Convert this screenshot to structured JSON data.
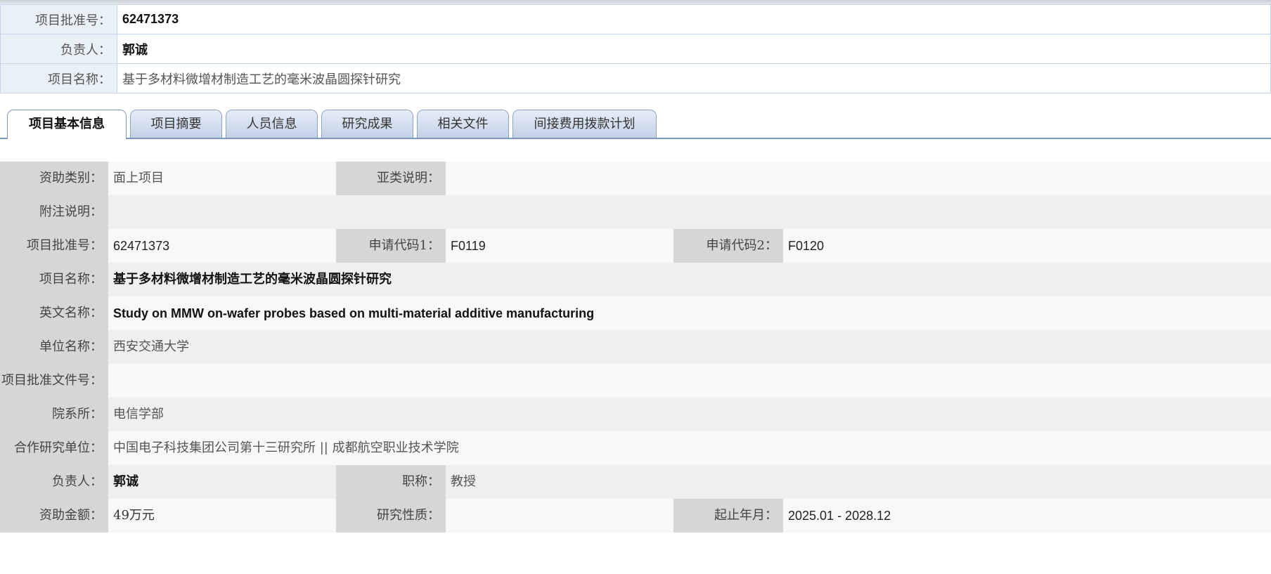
{
  "header": {
    "approval_no_label": "项目批准号：",
    "approval_no": "62471373",
    "leader_label": "负责人：",
    "leader": "郭诚",
    "project_name_label": "项目名称：",
    "project_name": "基于多材料微增材制造工艺的毫米波晶圆探针研究"
  },
  "tabs": [
    {
      "label": "项目基本信息",
      "active": true
    },
    {
      "label": "项目摘要"
    },
    {
      "label": "人员信息"
    },
    {
      "label": "研究成果"
    },
    {
      "label": "相关文件"
    },
    {
      "label": "间接费用拨款计划"
    }
  ],
  "details": {
    "funding_type_label": "资助类别：",
    "funding_type": "面上项目",
    "subtype_label": "亚类说明：",
    "subtype": "",
    "note_label": "附注说明：",
    "note": "",
    "approval_no_label": "项目批准号：",
    "approval_no": "62471373",
    "code1_label": "申请代码1：",
    "code1": "F0119",
    "code2_label": "申请代码2：",
    "code2": "F0120",
    "project_name_label": "项目名称：",
    "project_name": "基于多材料微增材制造工艺的毫米波晶圆探针研究",
    "english_name_label": "英文名称：",
    "english_name": "Study on MMW on-wafer probes based on multi-material additive manufacturing",
    "institution_label": "单位名称：",
    "institution": "西安交通大学",
    "approval_doc_label": "项目批准文件号：",
    "approval_doc": "",
    "department_label": "院系所：",
    "department": "电信学部",
    "partners_label": "合作研究单位：",
    "partners": "中国电子科技集团公司第十三研究所 || 成都航空职业技术学院",
    "leader_label": "负责人：",
    "leader": "郭诚",
    "title_label": "职称：",
    "title": "教授",
    "amount_label": "资助金额：",
    "amount": "49万元",
    "nature_label": "研究性质：",
    "nature": "",
    "period_label": "起止年月：",
    "period": "2025.01 - 2028.12"
  },
  "colors": {
    "header_label_bg": "#e9f0f8",
    "header_border": "#c6d6ea",
    "tab_border": "#7e97bd",
    "grid_label_bg": "#d6d6d6",
    "row_odd_bg": "#f8f8f8",
    "row_even_bg": "#efefef"
  }
}
